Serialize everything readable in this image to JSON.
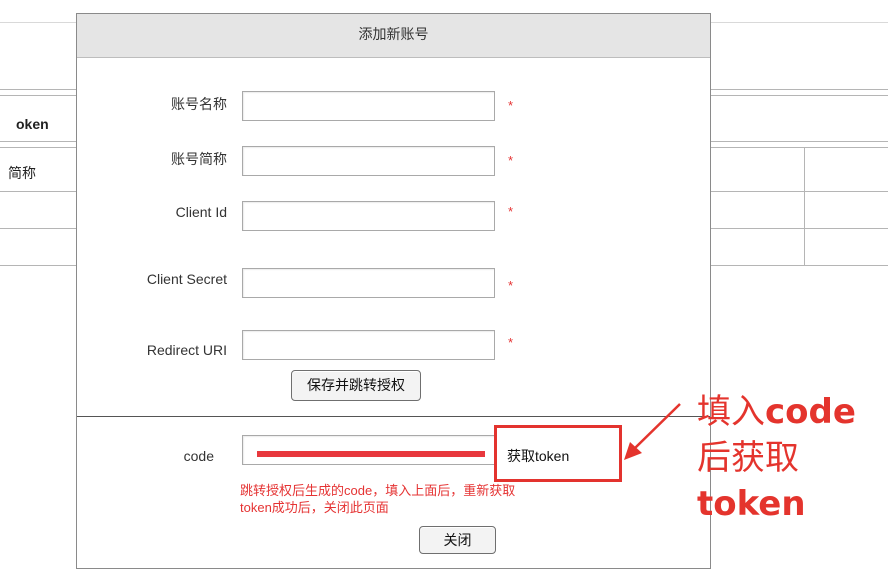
{
  "background": {
    "tab_label": "oken",
    "cell_label": "简称"
  },
  "dialog": {
    "title": "添加新账号",
    "fields": [
      {
        "label": "账号名称",
        "value": "",
        "required_mark": "*"
      },
      {
        "label": "账号简称",
        "value": "",
        "required_mark": "*"
      },
      {
        "label": "Client Id",
        "value": "",
        "required_mark": "*"
      },
      {
        "label": "Client Secret",
        "value": "",
        "required_mark": "*"
      },
      {
        "label": "Redirect URI",
        "value": "",
        "required_mark": "*"
      }
    ],
    "save_button": "保存并跳转授权",
    "code_label": "code",
    "get_token_button": "获取token",
    "hint_line1": "跳转授权后生成的code，填入上面后，重新获取",
    "hint_line2": "token成功后，关闭此页面",
    "close_button": "关闭"
  },
  "annotation": {
    "line1_a": "填入",
    "line1_b": "code",
    "line2": "后获取",
    "line3": "token",
    "color": "#e4342d"
  }
}
